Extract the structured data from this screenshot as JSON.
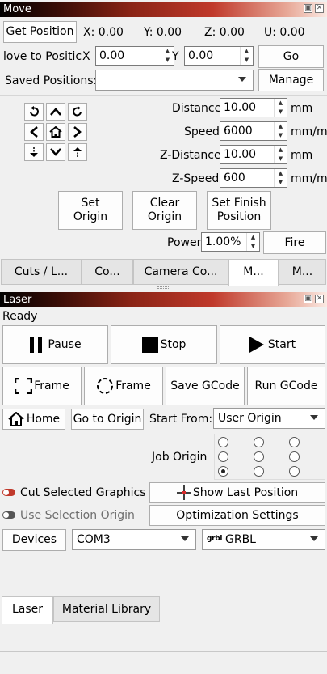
{
  "move": {
    "title": "Move",
    "get_position": "Get Position",
    "coords": {
      "x": "X: 0.00",
      "y": "Y: 0.00",
      "z": "Z: 0.00",
      "u": "U: 0.00"
    },
    "move_to_label": "love to Positic",
    "x_label": "X",
    "y_label": "Y",
    "x_value": "0.00",
    "y_value": "0.00",
    "go": "Go",
    "saved_positions_label": "Saved Positions:",
    "saved_positions_value": "",
    "manage": "Manage",
    "distance_label": "Distance",
    "distance_value": "10.00",
    "distance_unit": "mm",
    "speed_label": "Speed",
    "speed_value": "6000",
    "speed_unit": "mm/m",
    "z_distance_label": "Z-Distance",
    "z_distance_value": "10.00",
    "z_distance_unit": "mm",
    "z_speed_label": "Z-Speed",
    "z_speed_value": "600",
    "z_speed_unit": "mm/m",
    "set_origin": [
      "Set",
      "Origin"
    ],
    "clear_origin": [
      "Clear",
      "Origin"
    ],
    "set_finish": [
      "Set Finish",
      "Position"
    ],
    "power_label": "Power",
    "power_value": "1.00%",
    "fire": "Fire",
    "tabs": [
      "Cuts / L...",
      "Co...",
      "Camera Co...",
      "M...",
      "M..."
    ]
  },
  "laser": {
    "title": "Laser",
    "status": "Ready",
    "pause": "Pause",
    "stop": "Stop",
    "start": "Start",
    "frame1": "Frame",
    "frame2": "Frame",
    "save_gcode": "Save GCode",
    "run_gcode": "Run GCode",
    "home": "Home",
    "go_to_origin": "Go to Origin",
    "start_from_label": "Start From:",
    "start_from_value": "User Origin",
    "job_origin_label": "Job Origin",
    "cut_selected": "Cut Selected Graphics",
    "show_last_position": "Show Last Position",
    "use_selection_origin": "Use Selection Origin",
    "optimization_settings": "Optimization Settings",
    "devices": "Devices",
    "port": "COM3",
    "controller_badge": "grbl",
    "controller": "GRBL",
    "tabs": [
      "Laser",
      "Material Library"
    ]
  }
}
